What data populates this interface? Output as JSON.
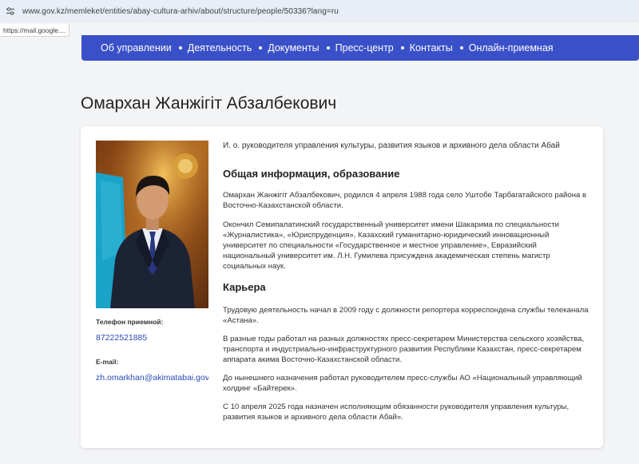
{
  "browser": {
    "url": "www.gov.kz/memleket/entities/abay-cultura-arhiv/about/structure/people/50336?lang=ru",
    "hover_url": "https://mail.google...."
  },
  "nav": {
    "items": [
      "Об управлении",
      "Деятельность",
      "Документы",
      "Пресс-центр",
      "Контакты",
      "Онлайн-приемная"
    ]
  },
  "page": {
    "title": "Омархан Жанжігіт Абзалбекович"
  },
  "profile": {
    "position": "И. о. руководителя управления культуры, развития языков и архивного дела области Абай",
    "phone_label": "Телефон приемной:",
    "phone": "87222521885",
    "email_label": "E-mail:",
    "email": "zh.omarkhan@akimatabai.gov.kz"
  },
  "sections": {
    "general_title": "Общая информация, образование",
    "general_p1": "Омархан Жанжігіт Абзалбекович, родился 4 апреля 1988 года село Уштобе Тарбагатайского района в Восточно-Казахстанской области.",
    "general_p2": "Окончил Семипалатинский государственный университет имени Шакарима по специальности «Журналистика», «Юриспруденция», Казахский гуманитарно-юридический инновационный университет по специальности «Государственное и местное управление», Евразийский национальный  университет им. Л.Н. Гумилева присуждена академическая степень магистр социальных наук.",
    "career_title": "Карьера",
    "career_p1": "Трудовую деятельность начал в 2009 году с должности репортера корреспондена службы телеканала «Астана».",
    "career_p2": "В разные годы работал на разных должностях пресс-секретарем Министерства сельского хозяйства, транспорта и индустриально-инфраструктурного развития Республики Казахстан, пресс-секретарем аппарата акима Восточно-Казахстанской области.",
    "career_p3": "До нынешнего назначения работал руководителем пресс-службы АО «Национальный управляющий холдинг «Байтерек».",
    "career_p4": "С 10 апреля 2025 года назначен исполняющим обязанности руководителя управления культуры, развития языков и архивного дела области Абай»."
  }
}
